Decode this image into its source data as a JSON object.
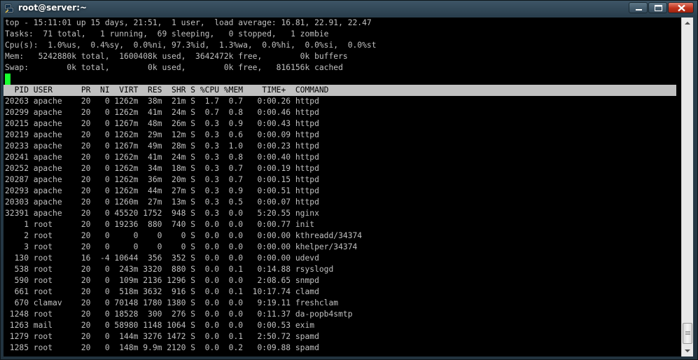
{
  "window": {
    "title": "root@server:~",
    "colors": {
      "close": "#c0321b",
      "frame": "#2a3f4d"
    }
  },
  "top": {
    "summary_lines": [
      "top - 15:11:01 up 15 days, 21:51,  1 user,  load average: 16.81, 22.91, 22.47",
      "Tasks:  71 total,   1 running,  69 sleeping,   0 stopped,   1 zombie",
      "Cpu(s):  1.0%us,  0.4%sy,  0.0%ni, 97.3%id,  1.3%wa,  0.0%hi,  0.0%si,  0.0%st",
      "Mem:   5242880k total,  1600408k used,  3642472k free,        0k buffers",
      "Swap:        0k total,        0k used,        0k free,   816156k cached"
    ],
    "header": "  PID USER      PR  NI  VIRT  RES  SHR S %CPU %MEM    TIME+  COMMAND",
    "rows": [
      "20263 apache    20   0 1262m  38m  21m S  1.7  0.7   0:00.26 httpd",
      "20299 apache    20   0 1262m  41m  24m S  0.7  0.8   0:00.46 httpd",
      "20215 apache    20   0 1267m  48m  26m S  0.3  0.9   0:00.43 httpd",
      "20219 apache    20   0 1262m  29m  12m S  0.3  0.6   0:00.09 httpd",
      "20233 apache    20   0 1267m  49m  28m S  0.3  1.0   0:00.23 httpd",
      "20241 apache    20   0 1262m  41m  24m S  0.3  0.8   0:00.40 httpd",
      "20252 apache    20   0 1262m  34m  18m S  0.3  0.7   0:00.19 httpd",
      "20287 apache    20   0 1262m  36m  20m S  0.3  0.7   0:00.15 httpd",
      "20293 apache    20   0 1262m  44m  27m S  0.3  0.9   0:00.51 httpd",
      "20303 apache    20   0 1260m  27m  13m S  0.3  0.5   0:00.07 httpd",
      "32391 apache    20   0 45520 1752  948 S  0.3  0.0   5:20.55 nginx",
      "    1 root      20   0 19236  880  740 S  0.0  0.0   0:00.77 init",
      "    2 root      20   0     0    0    0 S  0.0  0.0   0:00.00 kthreadd/34374",
      "    3 root      20   0     0    0    0 S  0.0  0.0   0:00.00 khelper/34374",
      "  130 root      16  -4 10644  356  352 S  0.0  0.0   0:00.00 udevd",
      "  538 root      20   0  243m 3320  880 S  0.0  0.1   0:14.88 rsyslogd",
      "  590 root      20   0  109m 2136 1296 S  0.0  0.0   2:08.65 snmpd",
      "  661 root      20   0  518m 3632  916 S  0.0  0.1  10:17.74 clamd",
      "  670 clamav    20   0 70148 1780 1380 S  0.0  0.0   9:19.11 freshclam",
      " 1248 root      20   0 18528  300  276 S  0.0  0.0   0:11.37 da-popb4smtp",
      " 1263 mail      20   0 58980 1148 1064 S  0.0  0.0   0:00.53 exim",
      " 1279 root      20   0  144m 3276 1472 S  0.0  0.1   2:50.72 spamd",
      " 1285 root      20   0  148m 9.9m 2120 S  0.0  0.2   0:09.88 spamd"
    ],
    "colors": {
      "cursor": "#17ff2f",
      "header_bg": "#c0c0c0",
      "text": "#c0c0c0",
      "background": "#000000"
    }
  },
  "icons": {
    "app": "putty-icon",
    "minimize": "minimize-icon",
    "maximize": "maximize-icon",
    "close": "close-icon",
    "scroll_up": "arrow-up-icon",
    "scroll_down": "arrow-down-icon"
  }
}
